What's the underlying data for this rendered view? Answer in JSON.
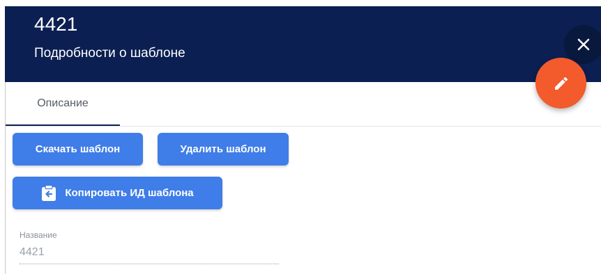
{
  "header": {
    "title": "4421",
    "subtitle": "Подробности о шаблоне",
    "background_color": "#0b1f52"
  },
  "icons": {
    "close": "close-icon",
    "edit": "pencil-icon",
    "copy": "clipboard-copy-icon"
  },
  "fab": {
    "color": "#f35a2c"
  },
  "tabs": [
    {
      "label": "Описание",
      "active": true
    }
  ],
  "actions": {
    "download_label": "Скачать шаблон",
    "delete_label": "Удалить шаблон",
    "copy_id_label": "Копировать ИД шаблона",
    "button_color": "#3f7de8"
  },
  "fields": {
    "name": {
      "label": "Название",
      "value": "4421"
    }
  }
}
